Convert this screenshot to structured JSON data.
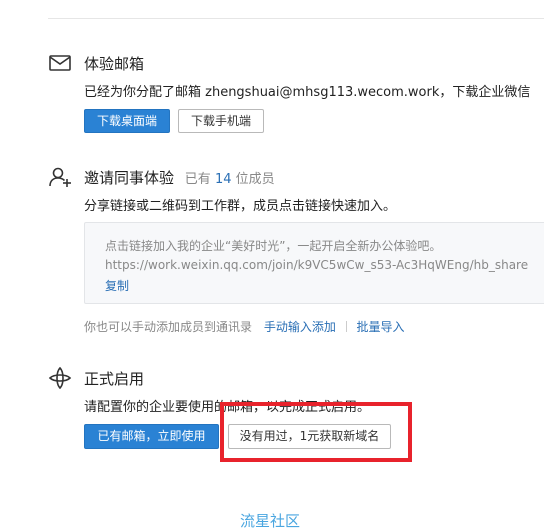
{
  "mailbox": {
    "title": "体验邮箱",
    "desc": "已经为你分配了邮箱 zhengshuai@mhsg113.wecom.work，下载企业微信",
    "download_desktop": "下载桌面端",
    "download_mobile": "下载手机端"
  },
  "invite": {
    "title": "邀请同事体验",
    "member_prefix": "已有",
    "member_count": "14",
    "member_suffix": "位成员",
    "desc": "分享链接或二维码到工作群，成员点击链接快速加入。",
    "invite_message": "点击链接加入我的企业“美好时光”，一起开启全新办公体验吧。",
    "invite_url": "https://work.weixin.qq.com/join/k9VC5wCw_s53-Ac3HqWEng/hb_share",
    "copy_label": "复制",
    "manual_text": "你也可以手动添加成员到通讯录",
    "manual_add": "手动输入添加",
    "batch_import": "批量导入"
  },
  "launch": {
    "title": "正式启用",
    "desc": "请配置你的企业要使用的邮箱，以完成正式启用。",
    "has_mailbox": "已有邮箱，立即使用",
    "get_domain": "没有用过，1元获取新域名"
  },
  "footer": {
    "link": "流星社区"
  },
  "colors": {
    "primary": "#2a82d4",
    "link": "#2a6fb5",
    "highlight": "#e8232c",
    "footer_link": "#4aa6e0"
  }
}
